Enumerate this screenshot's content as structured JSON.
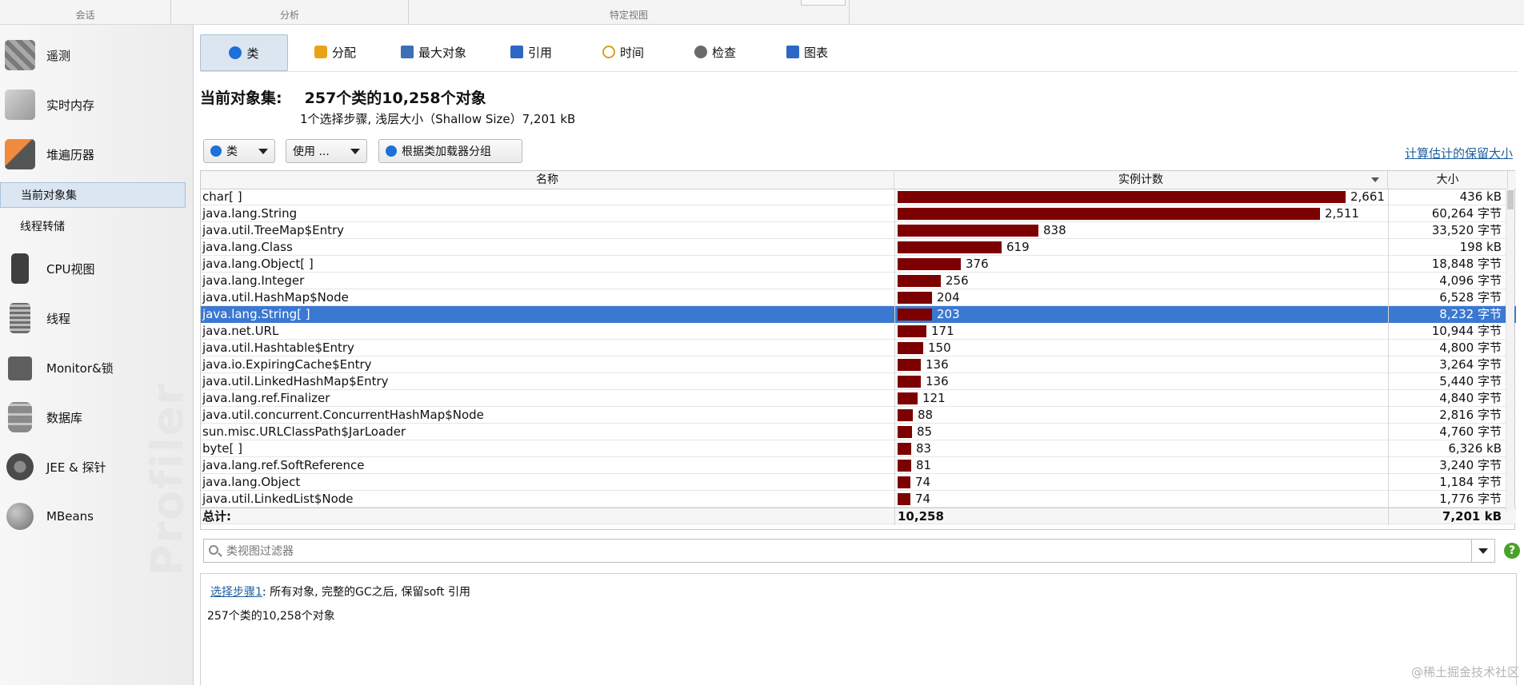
{
  "ribbon": {
    "groups": [
      "会话",
      "分析",
      "特定视图"
    ]
  },
  "sidebar": {
    "items": [
      {
        "label": "遥测",
        "icon": "telemetry-icon",
        "color": "#8a8a8a"
      },
      {
        "label": "实时内存",
        "icon": "memory-cubes-icon",
        "color": "#b4b4b4"
      },
      {
        "label": "堆遍历器",
        "icon": "camera-icon",
        "color": "#e26b1d"
      },
      {
        "label": "CPU视图",
        "icon": "cpu-chip-icon",
        "color": "#4a4a4a"
      },
      {
        "label": "线程",
        "icon": "thread-spool-icon",
        "color": "#7d7d7d"
      },
      {
        "label": "Monitor&锁",
        "icon": "lock-icon",
        "color": "#6c6c6c"
      },
      {
        "label": "数据库",
        "icon": "database-icon",
        "color": "#8f8f8f"
      },
      {
        "label": "JEE & 探针",
        "icon": "gauge-icon",
        "color": "#5e5e5e"
      },
      {
        "label": "MBeans",
        "icon": "globe-icon",
        "color": "#909090"
      }
    ],
    "subitems": [
      "当前对象集",
      "线程转储"
    ],
    "watermark": "Profiler"
  },
  "tabs": [
    {
      "label": "类",
      "icon": "class-icon",
      "color": "#1e6fd9"
    },
    {
      "label": "分配",
      "icon": "allocation-icon",
      "color": "#e8a317"
    },
    {
      "label": "最大对象",
      "icon": "biggest-objects-icon",
      "color": "#3b6fb6"
    },
    {
      "label": "引用",
      "icon": "references-icon",
      "color": "#2d67c4"
    },
    {
      "label": "时间",
      "icon": "clock-icon",
      "color": "#d5a21f"
    },
    {
      "label": "检查",
      "icon": "gear-icon",
      "color": "#6a6a6a"
    },
    {
      "label": "图表",
      "icon": "graph-icon",
      "color": "#2d67c4"
    }
  ],
  "header": {
    "label": "当前对象集:",
    "value": "257个类的10,258个对象",
    "subline": "1个选择步骤, 浅层大小（Shallow Size）7,201 kB"
  },
  "toolbar": {
    "class_select": "类",
    "use_button": "使用 ...",
    "group_button": "根据类加载器分组",
    "calc_link": "计算估计的保留大小"
  },
  "table": {
    "columns": [
      "名称",
      "实例计数",
      "大小"
    ],
    "max_count": 2661,
    "rows": [
      {
        "name": "char[ ]",
        "count": 2661,
        "count_label": "2,661",
        "size": "436 kB"
      },
      {
        "name": "java.lang.String",
        "count": 2511,
        "count_label": "2,511",
        "size": "60,264 字节"
      },
      {
        "name": "java.util.TreeMap$Entry",
        "count": 838,
        "count_label": "838",
        "size": "33,520 字节"
      },
      {
        "name": "java.lang.Class",
        "count": 619,
        "count_label": "619",
        "size": "198 kB"
      },
      {
        "name": "java.lang.Object[ ]",
        "count": 376,
        "count_label": "376",
        "size": "18,848 字节"
      },
      {
        "name": "java.lang.Integer",
        "count": 256,
        "count_label": "256",
        "size": "4,096 字节"
      },
      {
        "name": "java.util.HashMap$Node",
        "count": 204,
        "count_label": "204",
        "size": "6,528 字节"
      },
      {
        "name": "java.lang.String[ ]",
        "count": 203,
        "count_label": "203",
        "size": "8,232 字节",
        "selected": true
      },
      {
        "name": "java.net.URL",
        "count": 171,
        "count_label": "171",
        "size": "10,944 字节"
      },
      {
        "name": "java.util.Hashtable$Entry",
        "count": 150,
        "count_label": "150",
        "size": "4,800 字节"
      },
      {
        "name": "java.io.ExpiringCache$Entry",
        "count": 136,
        "count_label": "136",
        "size": "3,264 字节"
      },
      {
        "name": "java.util.LinkedHashMap$Entry",
        "count": 136,
        "count_label": "136",
        "size": "5,440 字节"
      },
      {
        "name": "java.lang.ref.Finalizer",
        "count": 121,
        "count_label": "121",
        "size": "4,840 字节"
      },
      {
        "name": "java.util.concurrent.ConcurrentHashMap$Node",
        "count": 88,
        "count_label": "88",
        "size": "2,816 字节"
      },
      {
        "name": "sun.misc.URLClassPath$JarLoader",
        "count": 85,
        "count_label": "85",
        "size": "4,760 字节"
      },
      {
        "name": "byte[ ]",
        "count": 83,
        "count_label": "83",
        "size": "6,326 kB"
      },
      {
        "name": "java.lang.ref.SoftReference",
        "count": 81,
        "count_label": "81",
        "size": "3,240 字节"
      },
      {
        "name": "java.lang.Object",
        "count": 74,
        "count_label": "74",
        "size": "1,184 字节"
      },
      {
        "name": "java.util.LinkedList$Node",
        "count": 74,
        "count_label": "74",
        "size": "1,776 字节"
      }
    ],
    "total": {
      "label": "总计:",
      "count": "10,258",
      "size": "7,201 kB"
    }
  },
  "filter": {
    "placeholder": "类视图过滤器"
  },
  "info": {
    "step_link": "选择步骤1",
    "step_text": ": 所有对象, 完整的GC之后, 保留soft 引用",
    "summary": "257个类的10,258个对象"
  },
  "corner_text": "@稀土掘金技术社区",
  "colors": {
    "bar": "#7c0000",
    "selection": "#3b78d1",
    "link": "#1f5f9e"
  }
}
